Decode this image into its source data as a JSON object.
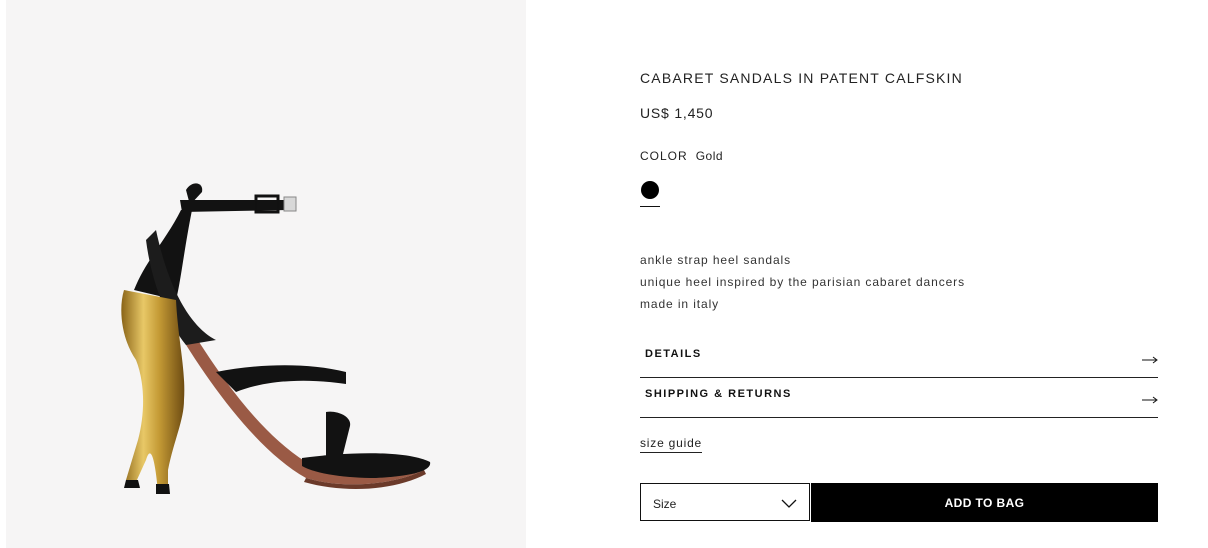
{
  "product": {
    "title": "CABARET SANDALS IN PATENT CALFSKIN",
    "price": "US$ 1,450",
    "color_label": "COLOR",
    "color_value": "Gold",
    "swatch_color": "#000000",
    "description": [
      "ankle strap heel sandals",
      "unique heel inspired by the parisian cabaret dancers",
      "made in italy"
    ]
  },
  "accordions": {
    "details": "DETAILS",
    "shipping": "SHIPPING & RETURNS"
  },
  "size_guide": "size guide",
  "size_select": {
    "label": "Size"
  },
  "add_to_bag": "ADD TO BAG",
  "colors": {
    "panel_bg": "#f6f5f5",
    "button_bg": "#000000",
    "gold": "#c9a23a",
    "patent": "#121212",
    "insole": "#9a5a45"
  }
}
